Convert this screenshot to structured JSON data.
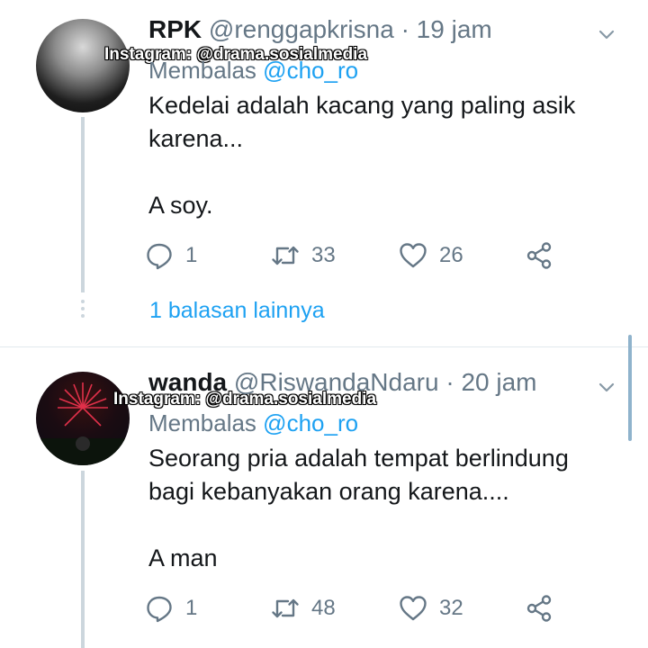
{
  "watermark": "Instagram: @drama.sosialmedia",
  "tweets": [
    {
      "name": "RPK",
      "handle": "@renggapkrisna",
      "separator": "·",
      "time": "19 jam",
      "reply_prefix": "Membalas",
      "reply_mention": "@cho_ro",
      "text_line1": "Kedelai adalah kacang yang paling asik karena...",
      "text_line2": "A soy.",
      "replies": "1",
      "retweets": "33",
      "likes": "26",
      "more_replies": "1 balasan lainnya"
    },
    {
      "name": "wanda",
      "handle": "@RiswandaNdaru",
      "separator": "·",
      "time": "20 jam",
      "reply_prefix": "Membalas",
      "reply_mention": "@cho_ro",
      "text_line1": "Seorang pria adalah tempat berlindung bagi kebanyakan orang karena....",
      "text_line2": "A man",
      "replies": "1",
      "retweets": "48",
      "likes": "32"
    }
  ],
  "icons": {
    "reply": "reply-icon",
    "retweet": "retweet-icon",
    "like": "heart-icon",
    "share": "share-icon",
    "caret": "chevron-down-icon"
  },
  "colors": {
    "link": "#1da1f2",
    "secondary_text": "#657786",
    "thread_line": "#ccd6dd"
  }
}
